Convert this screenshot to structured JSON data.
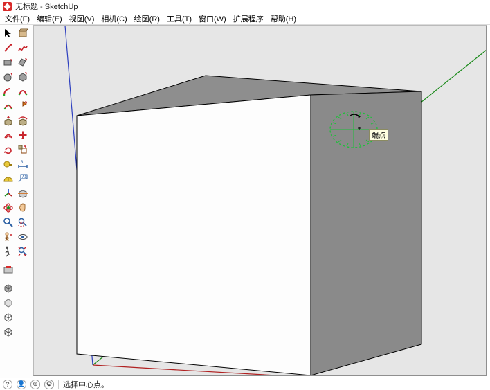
{
  "titlebar": {
    "title": "无标题 - SketchUp"
  },
  "menu": {
    "file": "文件(F)",
    "edit": "编辑(E)",
    "view": "视图(V)",
    "camera": "相机(C)",
    "draw": "绘图(R)",
    "tools": "工具(T)",
    "window": "窗口(W)",
    "ext": "扩展程序",
    "help": "帮助(H)"
  },
  "viewport": {
    "tooltip": "端点"
  },
  "status": {
    "hint": "选择中心点。"
  },
  "icons": {
    "select": "select-icon",
    "make": "make-component-icon",
    "line": "line-icon",
    "freehand": "freehand-icon",
    "rect": "rectangle-icon",
    "rotrect": "rotated-rectangle-icon",
    "circle": "circle-icon",
    "polygon": "polygon-icon",
    "arc": "arc-icon",
    "arc2": "arc-2point-icon",
    "arc3": "arc-3point-icon",
    "pie": "pie-icon",
    "push": "pushpull-icon",
    "follow": "followme-icon",
    "offset": "offset-icon",
    "move": "move-icon",
    "rotate": "rotate-icon",
    "scale": "scale-icon",
    "tape": "tape-icon",
    "dim": "dimension-icon",
    "protr": "protractor-icon",
    "text": "text-icon",
    "axes": "axes-icon",
    "plane": "section-plane-icon",
    "orbit": "orbit-icon",
    "pan": "pan-icon",
    "zoom": "zoom-icon",
    "zoomwin": "zoom-window-icon",
    "walk": "walk-icon",
    "look": "look-around-icon",
    "manager": "ext-manager-icon",
    "hcube": "house-cube-icon",
    "hsimple": "house-simple-icon",
    "hbox": "house-box-icon",
    "hwire": "house-wire-icon"
  }
}
